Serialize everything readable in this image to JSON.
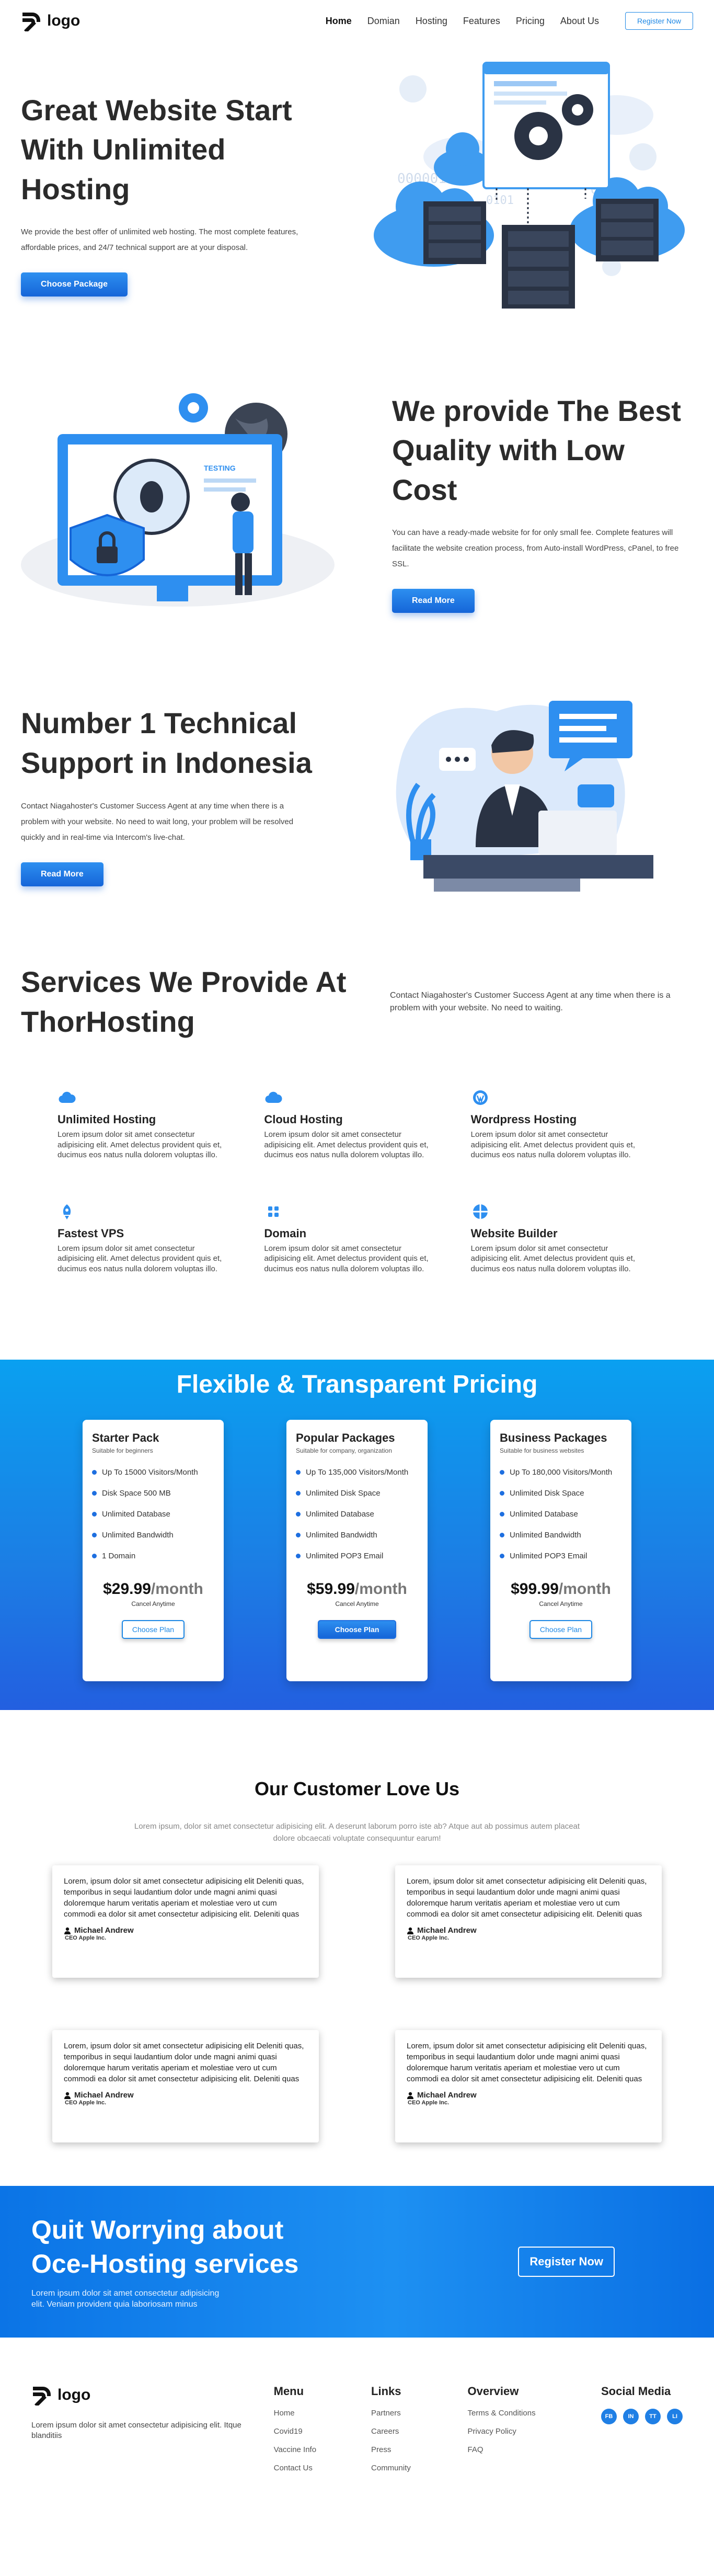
{
  "header": {
    "logo_text": "logo",
    "nav": [
      "Home",
      "Domian",
      "Hosting",
      "Features",
      "Pricing",
      "About Us"
    ],
    "register_label": "Register Now"
  },
  "hero1": {
    "title": "Great Website Start With Unlimited Hosting",
    "desc": "We provide the best offer of unlimited web hosting. The most complete features, affordable prices, and 24/7 technical support are at your disposal.",
    "button": "Choose Package",
    "illus_texts": [
      "0101",
      "0101",
      "0101",
      "000001"
    ]
  },
  "hero2": {
    "title": "We provide The Best Quality with Low Cost",
    "desc": "You can have a ready-made website for for only small fee. Complete features will facilitate the website creation process, from Auto-install WordPress, cPanel, to free SSL.",
    "button": "Read More",
    "illus_label": "TESTING"
  },
  "hero3": {
    "title": "Number 1 Technical Support in Indonesia",
    "desc": "Contact Niagahoster's Customer Success Agent at any time when there is a problem with your website. No need to wait long, your problem will be resolved quickly and in real-time via Intercom's live-chat.",
    "button": "Read More"
  },
  "services": {
    "title": "Services We Provide At ThorHosting",
    "desc": "Contact Niagahoster's Customer Success Agent at any time when there is a problem with your website. No need to waiting.",
    "items": [
      {
        "name": "Unlimited Hosting",
        "icon": "cloud-icon",
        "desc": "Lorem ipsum dolor sit amet consectetur adipisicing elit. Amet delectus provident quis et, ducimus eos natus nulla dolorem voluptas illo."
      },
      {
        "name": "Cloud Hosting",
        "icon": "cloud-icon",
        "desc": "Lorem ipsum dolor sit amet consectetur adipisicing elit. Amet delectus provident quis et, ducimus eos natus nulla dolorem voluptas illo."
      },
      {
        "name": "Wordpress Hosting",
        "icon": "wordpress-icon",
        "desc": "Lorem ipsum dolor sit amet consectetur adipisicing elit. Amet delectus provident quis et, ducimus eos natus nulla dolorem voluptas illo."
      },
      {
        "name": "Fastest VPS",
        "icon": "rocket-icon",
        "desc": "Lorem ipsum dolor sit amet consectetur adipisicing elit. Amet delectus provident quis et, ducimus eos natus nulla dolorem voluptas illo."
      },
      {
        "name": "Domain",
        "icon": "grid-icon",
        "desc": "Lorem ipsum dolor sit amet consectetur adipisicing elit. Amet delectus provident quis et, ducimus eos natus nulla dolorem voluptas illo."
      },
      {
        "name": "Website Builder",
        "icon": "builder-icon",
        "desc": "Lorem ipsum dolor sit amet consectetur adipisicing elit. Amet delectus provident quis et, ducimus eos natus nulla dolorem voluptas illo."
      }
    ]
  },
  "pricing": {
    "title": "Flexible & Transparent Pricing",
    "plans": [
      {
        "name": "Starter Pack",
        "sub": "Suitable for beginners",
        "features": [
          "Up To 15000 Visitors/Month",
          "Disk Space 500 MB",
          "Unlimited Database",
          "Unlimited Bandwidth",
          "1 Domain"
        ],
        "price": "$29.99",
        "per": "/month",
        "cancel": "Cancel Anytime",
        "button": "Choose Plan"
      },
      {
        "name": "Popular Packages",
        "sub": "Suitable for company, organization",
        "features": [
          "Up To 135,000 Visitors/Month",
          "Unlimited Disk Space",
          "Unlimited Database",
          "Unlimited Bandwidth",
          "Unlimited POP3 Email"
        ],
        "price": "$59.99",
        "per": "/month",
        "cancel": "Cancel Anytime",
        "button": "Choose Plan"
      },
      {
        "name": "Business Packages",
        "sub": "Suitable for business websites",
        "features": [
          "Up To 180,000 Visitors/Month",
          "Unlimited Disk Space",
          "Unlimited Database",
          "Unlimited Bandwidth",
          "Unlimited POP3 Email"
        ],
        "price": "$99.99",
        "per": "/month",
        "cancel": "Cancel Anytime",
        "button": "Choose Plan"
      }
    ]
  },
  "testimonials": {
    "title": "Our Customer Love Us",
    "intro": "Lorem ipsum, dolor sit amet consectetur adipisicing elit. A deserunt laborum porro iste ab? Atque aut ab possimus autem placeat dolore obcaecati voluptate consequuntur earum!",
    "items": [
      {
        "text": "Lorem, ipsum dolor sit amet consectetur adipisicing elit Deleniti quas, temporibus in sequi laudantium dolor unde magni animi quasi doloremque harum veritatis aperiam et molestiae vero ut cum commodi ea dolor sit amet consectetur adipisicing elit. Deleniti quas",
        "author": "Michael Andrew",
        "role": "CEO Apple Inc."
      },
      {
        "text": "Lorem, ipsum dolor sit amet consectetur adipisicing elit Deleniti quas, temporibus in sequi laudantium dolor unde magni animi quasi doloremque harum veritatis aperiam et molestiae vero ut cum commodi ea dolor sit amet consectetur adipisicing elit. Deleniti quas",
        "author": "Michael Andrew",
        "role": "CEO Apple Inc."
      },
      {
        "text": "Lorem, ipsum dolor sit amet consectetur adipisicing elit Deleniti quas, temporibus in sequi laudantium dolor unde magni animi quasi doloremque harum veritatis aperiam et molestiae vero ut cum commodi ea dolor sit amet consectetur adipisicing elit. Deleniti quas",
        "author": "Michael Andrew",
        "role": "CEO Apple Inc."
      },
      {
        "text": "Lorem, ipsum dolor sit amet consectetur adipisicing elit Deleniti quas, temporibus in sequi laudantium dolor unde magni animi quasi doloremque harum veritatis aperiam et molestiae vero ut cum commodi ea dolor sit amet consectetur adipisicing elit. Deleniti quas",
        "author": "Michael Andrew",
        "role": "CEO Apple Inc."
      }
    ]
  },
  "cta": {
    "title": "Quit Worrying about Oce-Hosting services",
    "desc": "Lorem ipsum dolor sit amet consectetur adipisicing elit. Veniam provident quia laboriosam minus",
    "button": "Register Now"
  },
  "footer": {
    "logo_text": "logo",
    "desc": "Lorem ipsum dolor sit amet consectetur adipisicing elit. Itque blanditiis",
    "menu_title": "Menu",
    "menu": [
      "Home",
      "Covid19",
      "Vaccine Info",
      "Contact Us"
    ],
    "links_title": "Links",
    "links": [
      "Partners",
      "Careers",
      "Press",
      "Community"
    ],
    "overview_title": "Overview",
    "overview": [
      "Terms & Conditions",
      "Privacy Policy",
      "FAQ"
    ],
    "social_title": "Social Media",
    "social": [
      "FB",
      "IN",
      "TT",
      "LI"
    ]
  },
  "colors": {
    "primary": "#1e6fe0",
    "accent": "#1e88e5"
  }
}
